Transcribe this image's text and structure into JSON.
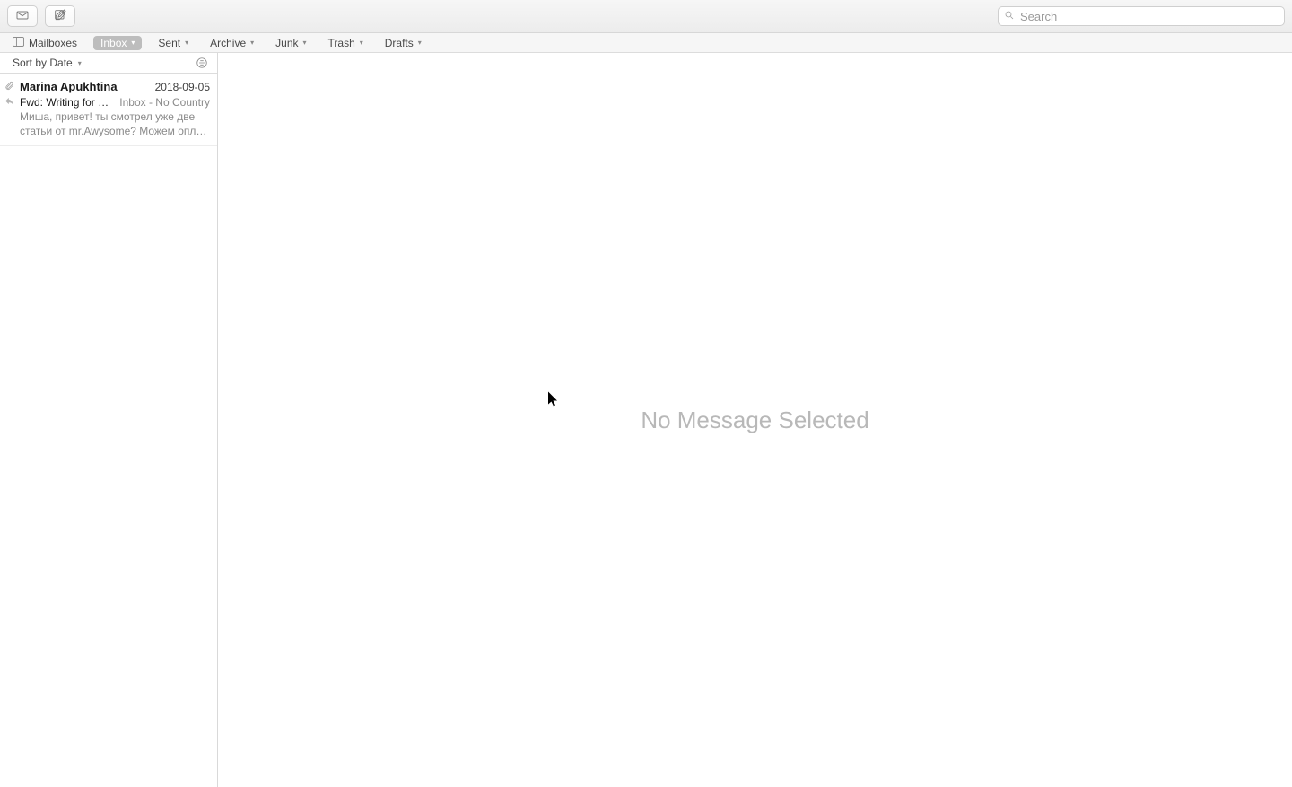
{
  "search": {
    "placeholder": "Search"
  },
  "favbar": {
    "mailboxes": "Mailboxes",
    "items": [
      {
        "label": "Inbox",
        "active": true,
        "has_chevron": true
      },
      {
        "label": "Sent",
        "active": false,
        "has_chevron": true
      },
      {
        "label": "Archive",
        "active": false,
        "has_chevron": true
      },
      {
        "label": "Junk",
        "active": false,
        "has_chevron": true
      },
      {
        "label": "Trash",
        "active": false,
        "has_chevron": true
      },
      {
        "label": "Drafts",
        "active": false,
        "has_chevron": true
      }
    ]
  },
  "list_header": {
    "sort_label": "Sort by Date"
  },
  "messages": [
    {
      "sender": "Marina Apukhtina",
      "date": "2018-09-05",
      "subject": "Fwd: Writing for S…",
      "mailbox": "Inbox - No Country",
      "preview": "Миша, привет! ты смотрел уже две статьи от mr.Awysome? Можем опл…",
      "has_attachment": true,
      "is_replied": true
    }
  ],
  "content": {
    "empty_text": "No Message Selected"
  }
}
